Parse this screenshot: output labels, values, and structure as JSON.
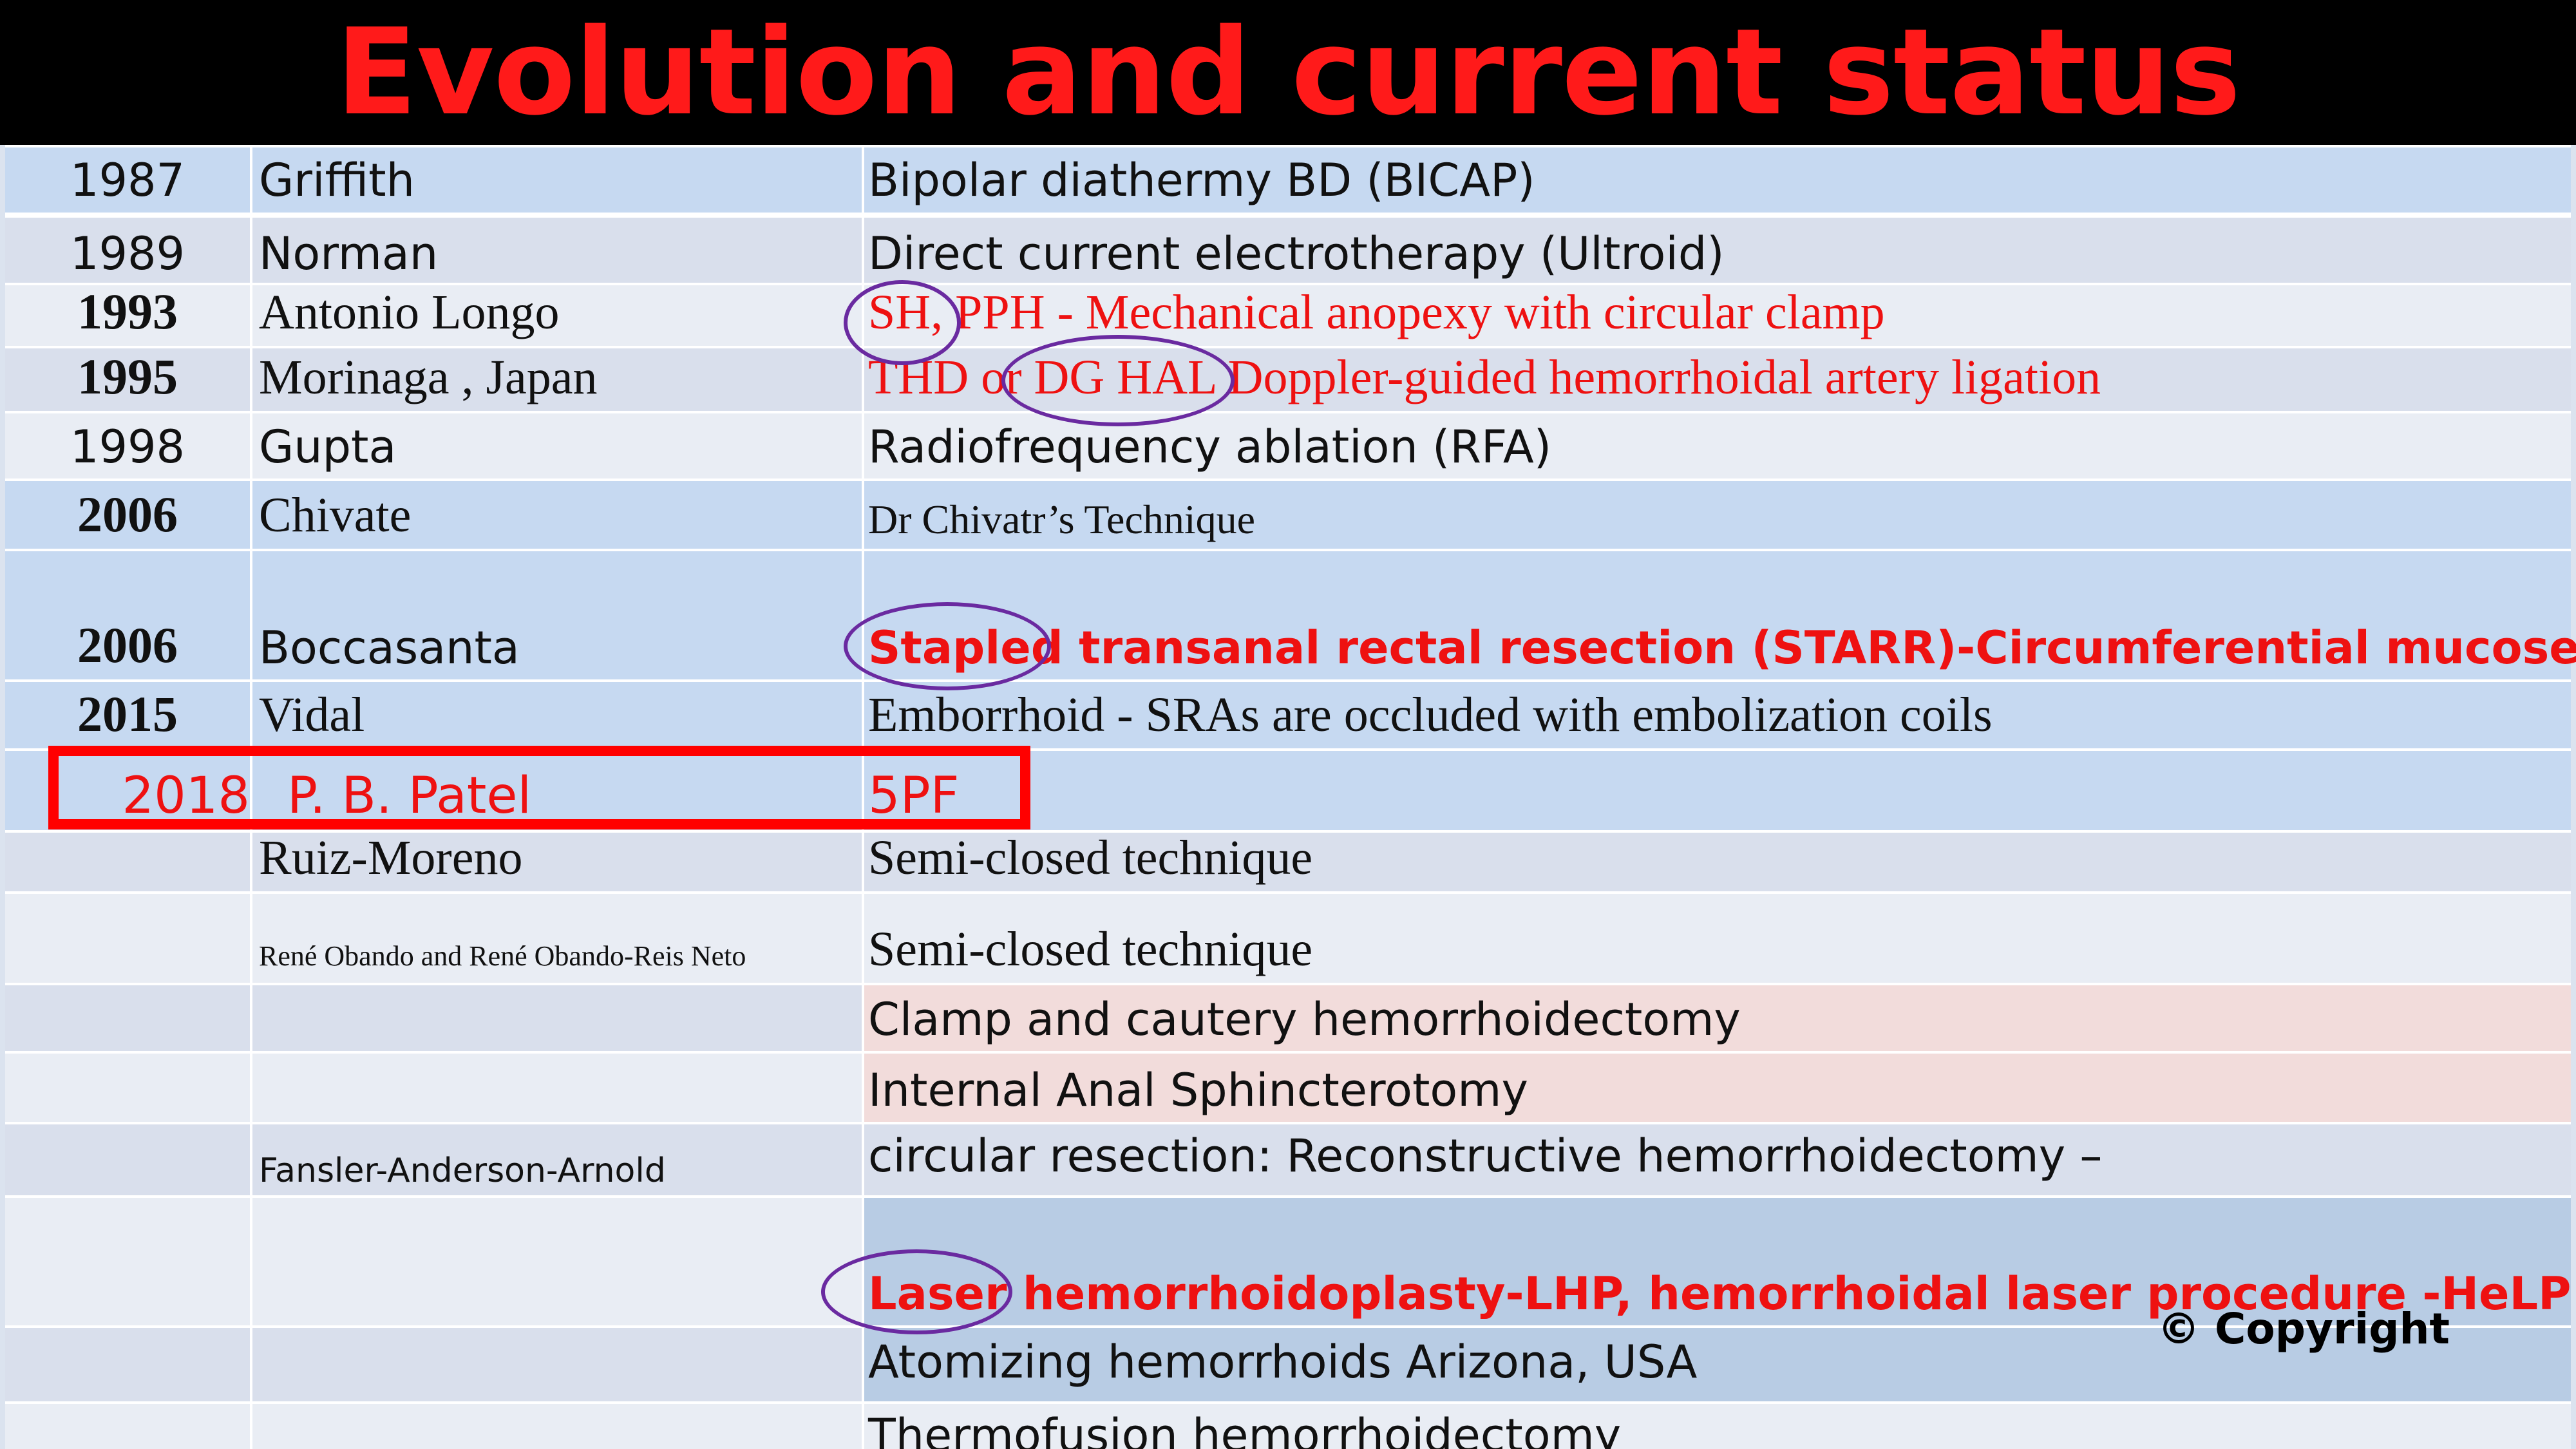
{
  "slide": {
    "title": "Evolution and current status",
    "rows": [
      {
        "year": "1987",
        "name": "Griffith",
        "technique": "Bipolar diathermy BD (BICAP)"
      },
      {
        "year": "1989",
        "name": "Norman",
        "technique": "Direct current electrotherapy  (Ultroid)"
      },
      {
        "year": "1993",
        "name": "Antonio Longo",
        "technique": "SH, PPH - Mechanical anopexy with circular clamp"
      },
      {
        "year": "1995",
        "name": "Morinaga , Japan",
        "technique": "THD or DG HAL Doppler-guided hemorrhoidal artery ligation"
      },
      {
        "year": "1998",
        "name": "Gupta",
        "technique": "Radiofrequency ablation (RFA)"
      },
      {
        "year": "2006",
        "name": "Chivate",
        "technique": "Dr Chivatr’s Technique"
      },
      {
        "year": "2006",
        "name": "Boccasanta",
        "technique": "Stapled transanal rectal resection (STARR)-Circumferential mucosectomy"
      },
      {
        "year": "2015",
        "name": "Vidal",
        "technique": "Emborrhoid - SRAs are occluded with embolization coils"
      },
      {
        "year": "2018",
        "name": "P. B. Patel",
        "technique": "5PF"
      },
      {
        "year": "",
        "name": "Ruiz-Moreno",
        "technique": "Semi-closed technique"
      },
      {
        "year": "",
        "name": "René Obando and René Obando-Reis Neto",
        "technique": "Semi-closed technique"
      },
      {
        "year": "",
        "name": "",
        "technique": "Clamp and cautery hemorrhoidectomy"
      },
      {
        "year": "",
        "name": "",
        "technique": "Internal Anal Sphincterotomy"
      },
      {
        "year": "",
        "name": "Fansler-Anderson-Arnold",
        "technique": "circular resection: Reconstructive hemorrhoidectomy –"
      },
      {
        "year": "",
        "name": "",
        "technique": "Laser hemorrhoidoplasty-LHP, hemorrhoidal laser procedure -HeLP"
      },
      {
        "year": "",
        "name": "",
        "technique": "Atomizing hemorrhoids  Arizona, USA"
      },
      {
        "year": "",
        "name": "",
        "technique": " Thermofusion hemorrhoidectomy"
      }
    ],
    "copyright": "©  Copyright"
  },
  "colors": {
    "title_bar": "#000000",
    "title_text": "#ff1a1a",
    "accent_red": "#ee1111",
    "row_blue": "#c6d9f1",
    "row_grey": "#d9dfec",
    "row_light": "#e9edf4",
    "row_pink": "#f2dcdb",
    "ellipse": "#6a2aa0",
    "highlight_box": "#ff0000"
  }
}
